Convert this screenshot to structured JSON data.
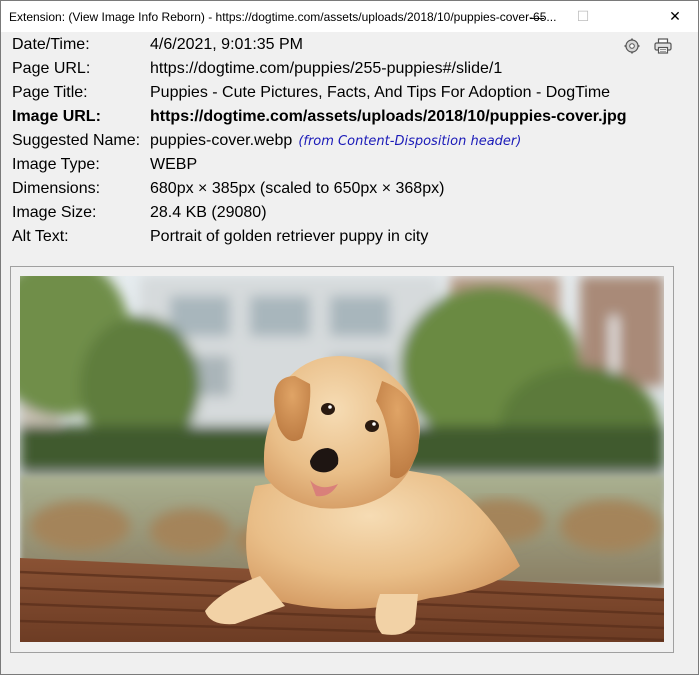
{
  "window": {
    "title": "Extension: (View Image Info Reborn) - https://dogtime.com/assets/uploads/2018/10/puppies-cover-65...",
    "minimize_glyph": "—",
    "maximize_glyph": "☐",
    "close_glyph": "✕"
  },
  "info": {
    "rows": [
      {
        "label": "Date/Time:",
        "value": "4/6/2021, 9:01:35 PM"
      },
      {
        "label": "Page URL:",
        "value": "https://dogtime.com/puppies/255-puppies#/slide/1"
      },
      {
        "label": "Page Title:",
        "value": "Puppies - Cute Pictures, Facts, And Tips For Adoption - DogTime"
      },
      {
        "label": "Image URL:",
        "value": "https://dogtime.com/assets/uploads/2018/10/puppies-cover.jpg"
      },
      {
        "label": "Suggested Name:",
        "value": "puppies-cover.webp",
        "note": "(from Content-Disposition header)"
      },
      {
        "label": "Image Type:",
        "value": "WEBP"
      },
      {
        "label": "Dimensions:",
        "value": "680px × 385px (scaled to 650px × 368px)"
      },
      {
        "label": "Image Size:",
        "value": "28.4 KB (29080)"
      },
      {
        "label": "Alt Text:",
        "value": "Portrait of golden retriever puppy in city"
      }
    ]
  },
  "toolbar": {
    "settings_icon": "gear-icon",
    "print_icon": "printer-icon"
  },
  "preview": {
    "alt": "Portrait of golden retriever puppy in city"
  }
}
